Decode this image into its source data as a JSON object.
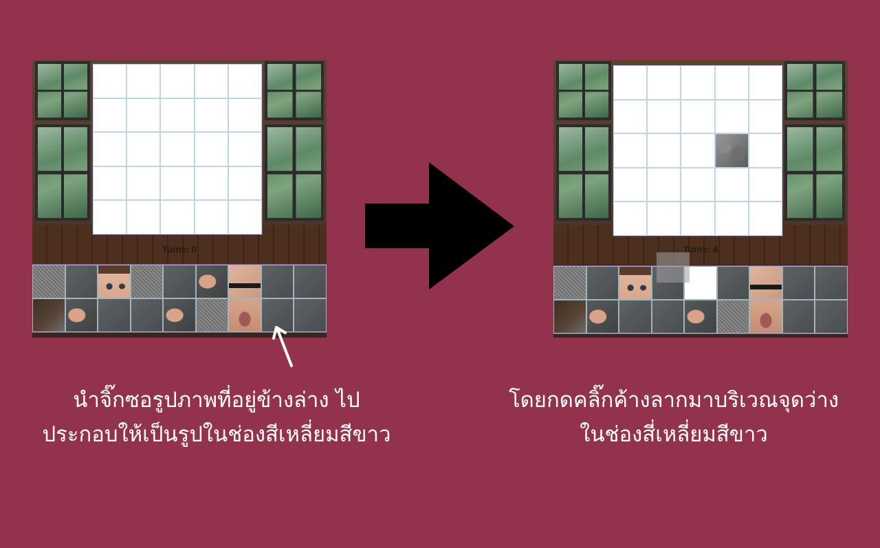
{
  "left_panel": {
    "turns_label": "Turns: 0"
  },
  "right_panel": {
    "turns_label": "Turns: 4"
  },
  "captions": {
    "left_line1": "นำจิ๊กซอรูปภาพที่อยู่ข้างล่าง ไป",
    "left_line2": "ประกอบให้เป็นรูปในช่องสีเหลี่ยมสีขาว",
    "right_line1": "โดยกดคลิ๊กค้างลากมาบริเวณจุดว่าง",
    "right_line2": "ในช่องสี่เหลี่ยมสีขาว"
  },
  "colors": {
    "background": "#93324d",
    "board": "#ffffff",
    "grid_line": "#bcd6e6",
    "arrow": "#000000",
    "caption_text": "#ffffff"
  },
  "icons": {
    "pointer_arrow": "white-arrow-icon",
    "flow_arrow": "black-right-arrow-icon"
  }
}
